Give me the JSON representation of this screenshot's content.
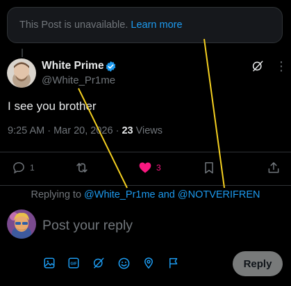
{
  "unavailable": {
    "text": "This Post is unavailable.",
    "link": "Learn more"
  },
  "post": {
    "author_name": "White Prime",
    "author_handle": "@White_Pr1me",
    "text": "I see you brother",
    "time": "9:25 AM",
    "date": "Mar 20, 2026",
    "views_count": "23",
    "views_label": "Views",
    "replies_count": "1",
    "reposts_count": "",
    "likes_count": "3",
    "liked": true
  },
  "reply": {
    "replying_to_prefix": "Replying to",
    "mention_1": "@White_Pr1me",
    "mention_conj": "and",
    "mention_2": "@NOTVERIFREN",
    "placeholder": "Post your reply",
    "button_label": "Reply"
  },
  "toolbar_icons": [
    "image-icon",
    "gif-icon",
    "grok-icon",
    "emoji-icon",
    "location-icon",
    "flag-icon"
  ],
  "colors": {
    "accent": "#1d9bf0",
    "like": "#f91880",
    "muted": "#71767b",
    "annotation": "#f5d020",
    "reply_button": "#787a7a"
  }
}
